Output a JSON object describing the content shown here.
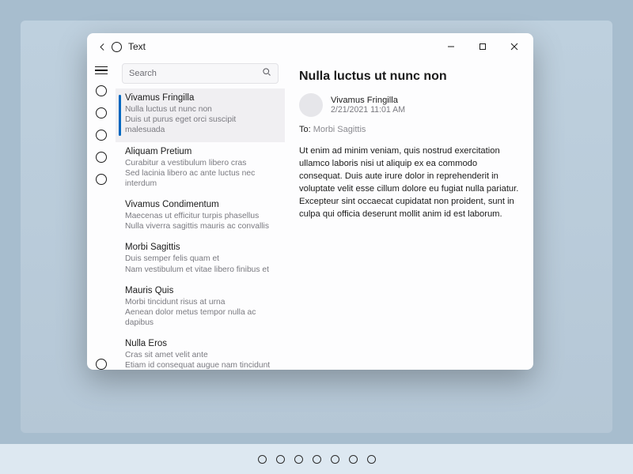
{
  "window": {
    "title": "Text"
  },
  "search": {
    "placeholder": "Search"
  },
  "list": [
    {
      "title": "Vivamus Fringilla",
      "line1": "Nulla luctus ut nunc non",
      "line2": "Duis ut purus eget orci suscipit malesuada",
      "selected": true
    },
    {
      "title": "Aliquam Pretium",
      "line1": "Curabitur a vestibulum libero cras",
      "line2": "Sed lacinia libero ac ante luctus nec interdum",
      "selected": false
    },
    {
      "title": "Vivamus Condimentum",
      "line1": "Maecenas ut efficitur turpis phasellus",
      "line2": "Nulla viverra sagittis mauris ac convallis",
      "selected": false
    },
    {
      "title": "Morbi Sagittis",
      "line1": "Duis semper felis quam et",
      "line2": "Nam vestibulum et vitae libero finibus et",
      "selected": false
    },
    {
      "title": "Mauris Quis",
      "line1": "Morbi tincidunt risus at urna",
      "line2": "Aenean dolor metus tempor nulla ac dapibus",
      "selected": false
    },
    {
      "title": "Nulla Eros",
      "line1": "Cras sit amet velit ante",
      "line2": "Etiam id consequat augue nam tincidunt",
      "selected": false
    }
  ],
  "detail": {
    "title": "Nulla luctus ut nunc non",
    "sender_name": "Vivamus Fringilla",
    "date": "2/21/2021 11:01 AM",
    "to_label": "To:",
    "to_value": "Morbi Sagittis",
    "body": "Ut enim ad minim veniam, quis nostrud exercitation ullamco laboris nisi ut aliquip ex ea commodo consequat. Duis aute irure dolor in reprehenderit in voluptate velit esse cillum dolore eu fugiat nulla pariatur. Excepteur sint occaecat cupidatat non proident, sunt in culpa qui officia deserunt mollit anim id est laborum."
  },
  "nav_count": 5,
  "page_dots": 7
}
